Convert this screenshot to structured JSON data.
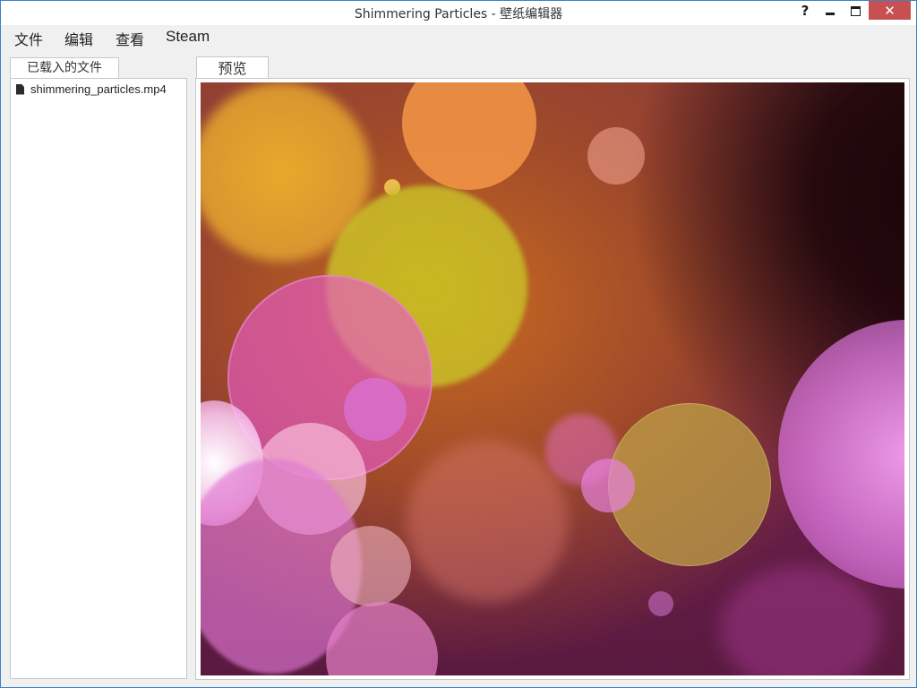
{
  "window": {
    "title": "Shimmering Particles - 壁纸编辑器",
    "help_label": "?",
    "close_label": "✕"
  },
  "menu": {
    "file": "文件",
    "edit": "编辑",
    "view": "查看",
    "steam": "Steam"
  },
  "files_panel": {
    "tab_label": "已载入的文件",
    "items": [
      {
        "name": "shimmering_particles.mp4",
        "icon": "file-icon"
      }
    ]
  },
  "preview_panel": {
    "tab_label": "预览"
  },
  "colors": {
    "window_border": "#3c83c8",
    "close_button": "#c75050",
    "panel_background": "#ffffff",
    "app_background": "#f0f0f0"
  }
}
